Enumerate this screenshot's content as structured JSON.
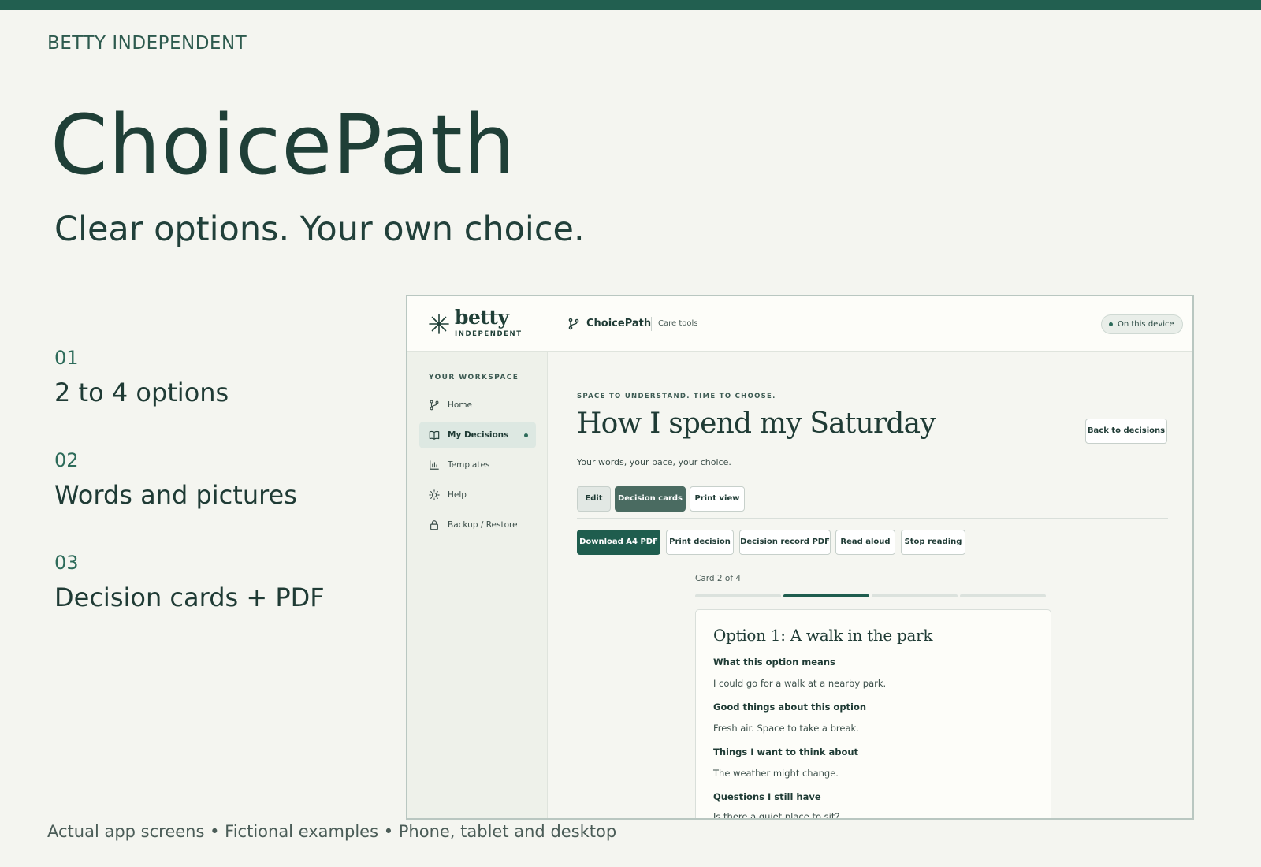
{
  "brand": "BETTY INDEPENDENT",
  "hero": {
    "title": "ChoicePath",
    "subtitle": "Clear options. Your own choice."
  },
  "features": [
    {
      "num": "01",
      "label": "2 to 4 options"
    },
    {
      "num": "02",
      "label": "Words and pictures"
    },
    {
      "num": "03",
      "label": "Decision cards + PDF"
    }
  ],
  "footer": "Actual app screens • Fictional examples • Phone, tablet and desktop",
  "app": {
    "logo_word": "betty",
    "logo_sub": "INDEPENDENT",
    "header_app": "ChoicePath",
    "header_tools": "Care tools",
    "device_status": "On this device",
    "sidebar": {
      "heading": "YOUR WORKSPACE",
      "items": [
        {
          "label": "Home",
          "icon": "branch-icon"
        },
        {
          "label": "My Decisions",
          "icon": "book-icon",
          "active": true
        },
        {
          "label": "Templates",
          "icon": "chart-icon"
        },
        {
          "label": "Help",
          "icon": "sun-icon"
        },
        {
          "label": "Backup / Restore",
          "icon": "lock-icon"
        }
      ]
    },
    "kicker": "SPACE TO UNDERSTAND. TIME TO CHOOSE.",
    "page_title": "How I spend my Saturday",
    "page_subtitle": "Your words, your pace, your choice.",
    "back_button": "Back to decisions",
    "view_tabs": [
      "Edit",
      "Decision cards",
      "Print view"
    ],
    "actions": [
      "Download A4 PDF",
      "Print decision",
      "Decision record PDF",
      "Read aloud",
      "Stop reading"
    ],
    "card_counter": "Card 2 of 4",
    "progress": {
      "current": 2,
      "total": 4
    },
    "card": {
      "title": "Option 1: A walk in the park",
      "sections": [
        {
          "heading": "What this option means",
          "text": "I could go for a walk at a nearby park."
        },
        {
          "heading": "Good things about this option",
          "text": "Fresh air. Space to take a break."
        },
        {
          "heading": "Things I want to think about",
          "text": "The weather might change."
        },
        {
          "heading": "Questions I still have",
          "text": "Is there a quiet place to sit?"
        }
      ]
    },
    "colors": {
      "accent": "#1f5d4e",
      "background": "#f4f5f0"
    }
  }
}
